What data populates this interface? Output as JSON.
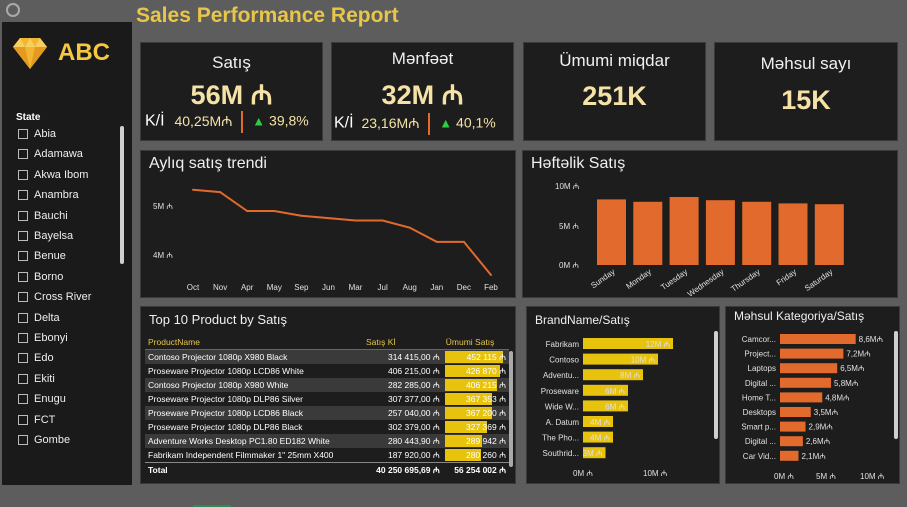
{
  "report_title": "Sales Performance Report",
  "logo": {
    "text": "ABC",
    "icon": "diamond-icon"
  },
  "slicer": {
    "header": "State",
    "items": [
      "Abia",
      "Adamawa",
      "Akwa Ibom",
      "Anambra",
      "Bauchi",
      "Bayelsa",
      "Benue",
      "Borno",
      "Cross River",
      "Delta",
      "Ebonyi",
      "Edo",
      "Ekiti",
      "Enugu",
      "FCT",
      "Gombe"
    ]
  },
  "kpis": {
    "sales": {
      "label": "Satış",
      "value": "56M ₼",
      "ki_label": "K/İ",
      "target": "40,25M₼",
      "change": "39,8%"
    },
    "profit": {
      "label": "Mənfəət",
      "value": "32M ₼",
      "ki_label": "K/İ",
      "target": "23,16M₼",
      "change": "40,1%"
    },
    "total_qty": {
      "label": "Ümumi miqdar",
      "value": "251K"
    },
    "product_count": {
      "label": "Məhsul sayı",
      "value": "15K"
    }
  },
  "colors": {
    "accent": "#e8c64a",
    "orange": "#e26a2c",
    "yellow_bar": "#e8c30e",
    "up": "#2ecc40"
  },
  "monthly": {
    "title": "Aylıq satış trendi",
    "y_ticks": [
      "5M ₼",
      "4M ₼"
    ]
  },
  "weekly": {
    "title": "Həftəlik Satış",
    "y_ticks": [
      "10M ₼",
      "5M ₼",
      "0M ₼"
    ]
  },
  "top10": {
    "title": "Top 10 Product by Satış",
    "headers": [
      "ProductName",
      "Satış Kİ",
      "Ümumi Satış"
    ],
    "rows": [
      [
        "Contoso Projector 1080p X980 Black",
        "314 415,00 ₼",
        "452 115 ₼"
      ],
      [
        "Proseware Projector 1080p LCD86 White",
        "406 215,00 ₼",
        "426 870 ₼"
      ],
      [
        "Contoso Projector 1080p X980 White",
        "282 285,00 ₼",
        "406 215 ₼"
      ],
      [
        "Proseware Projector 1080p DLP86 Silver",
        "307 377,00 ₼",
        "367 353 ₼"
      ],
      [
        "Proseware Projector 1080p LCD86 Black",
        "257 040,00 ₼",
        "367 200 ₼"
      ],
      [
        "Proseware Projector 1080p DLP86 Black",
        "302 379,00 ₼",
        "327 369 ₼"
      ],
      [
        "Adventure Works Desktop PC1.80 ED182 White",
        "280 443,90 ₼",
        "289 942 ₼"
      ],
      [
        "Fabrikam Independent Filmmaker 1\" 25mm X400",
        "187 920,00 ₼",
        "280 260 ₼"
      ]
    ],
    "total": [
      "Total",
      "40 250 695,69 ₼",
      "56 254 002 ₼"
    ]
  },
  "brand": {
    "title": "BrandName/Satış",
    "x_ticks": [
      "0M ₼",
      "10M ₼"
    ]
  },
  "category": {
    "title": "Məhsul Kategoriya/Satış",
    "x_ticks": [
      "0M ₼",
      "5M ₼",
      "10M ₼"
    ]
  },
  "chart_data": [
    {
      "type": "line",
      "title": "Aylıq satış trendi",
      "categories": [
        "Oct",
        "Nov",
        "Apr",
        "May",
        "Sep",
        "Jun",
        "Mar",
        "Jul",
        "Aug",
        "Jan",
        "Dec",
        "Feb"
      ],
      "values": [
        5.4,
        5.35,
        4.95,
        4.95,
        4.85,
        4.8,
        4.75,
        4.75,
        4.6,
        4.3,
        4.3,
        3.6
      ],
      "y_unit": "M ₼",
      "ylim": [
        3.6,
        5.5
      ]
    },
    {
      "type": "bar",
      "title": "Həftəlik Satış",
      "categories": [
        "Sunday",
        "Monday",
        "Tuesday",
        "Wednesday",
        "Thursday",
        "Friday",
        "Saturday"
      ],
      "values": [
        8.2,
        7.9,
        8.5,
        8.1,
        7.9,
        7.7,
        7.6
      ],
      "ylim": [
        0,
        10
      ],
      "y_unit": "M ₼"
    },
    {
      "type": "bar",
      "title": "BrandName/Satış",
      "orientation": "horizontal",
      "categories": [
        "Fabrikam",
        "Contoso",
        "Adventu...",
        "Proseware",
        "Wide W...",
        "A. Datum",
        "The Pho...",
        "Southrid..."
      ],
      "values": [
        12,
        10,
        8,
        6,
        6,
        4,
        4,
        3
      ],
      "labels": [
        "12M ₼",
        "10M ₼",
        "8M ₼",
        "6M ₼",
        "6M ₼",
        "4M ₼",
        "4M ₼",
        "3M ₼"
      ],
      "xlim": [
        0,
        12
      ]
    },
    {
      "type": "bar",
      "title": "Məhsul Kategoriya/Satış",
      "orientation": "horizontal",
      "categories": [
        "Camcor...",
        "Project...",
        "Laptops",
        "Digital ...",
        "Home T...",
        "Desktops",
        "Smart p...",
        "Digital ...",
        "Car Vid..."
      ],
      "values": [
        8.6,
        7.2,
        6.5,
        5.8,
        4.8,
        3.5,
        2.9,
        2.6,
        2.1
      ],
      "labels": [
        "8,6M₼",
        "7,2M₼",
        "6,5M₼",
        "5,8M₼",
        "4,8M₼",
        "3,5M₼",
        "2,9M₼",
        "2,6M₼",
        "2,1M₼"
      ],
      "xlim": [
        0,
        10
      ]
    }
  ]
}
